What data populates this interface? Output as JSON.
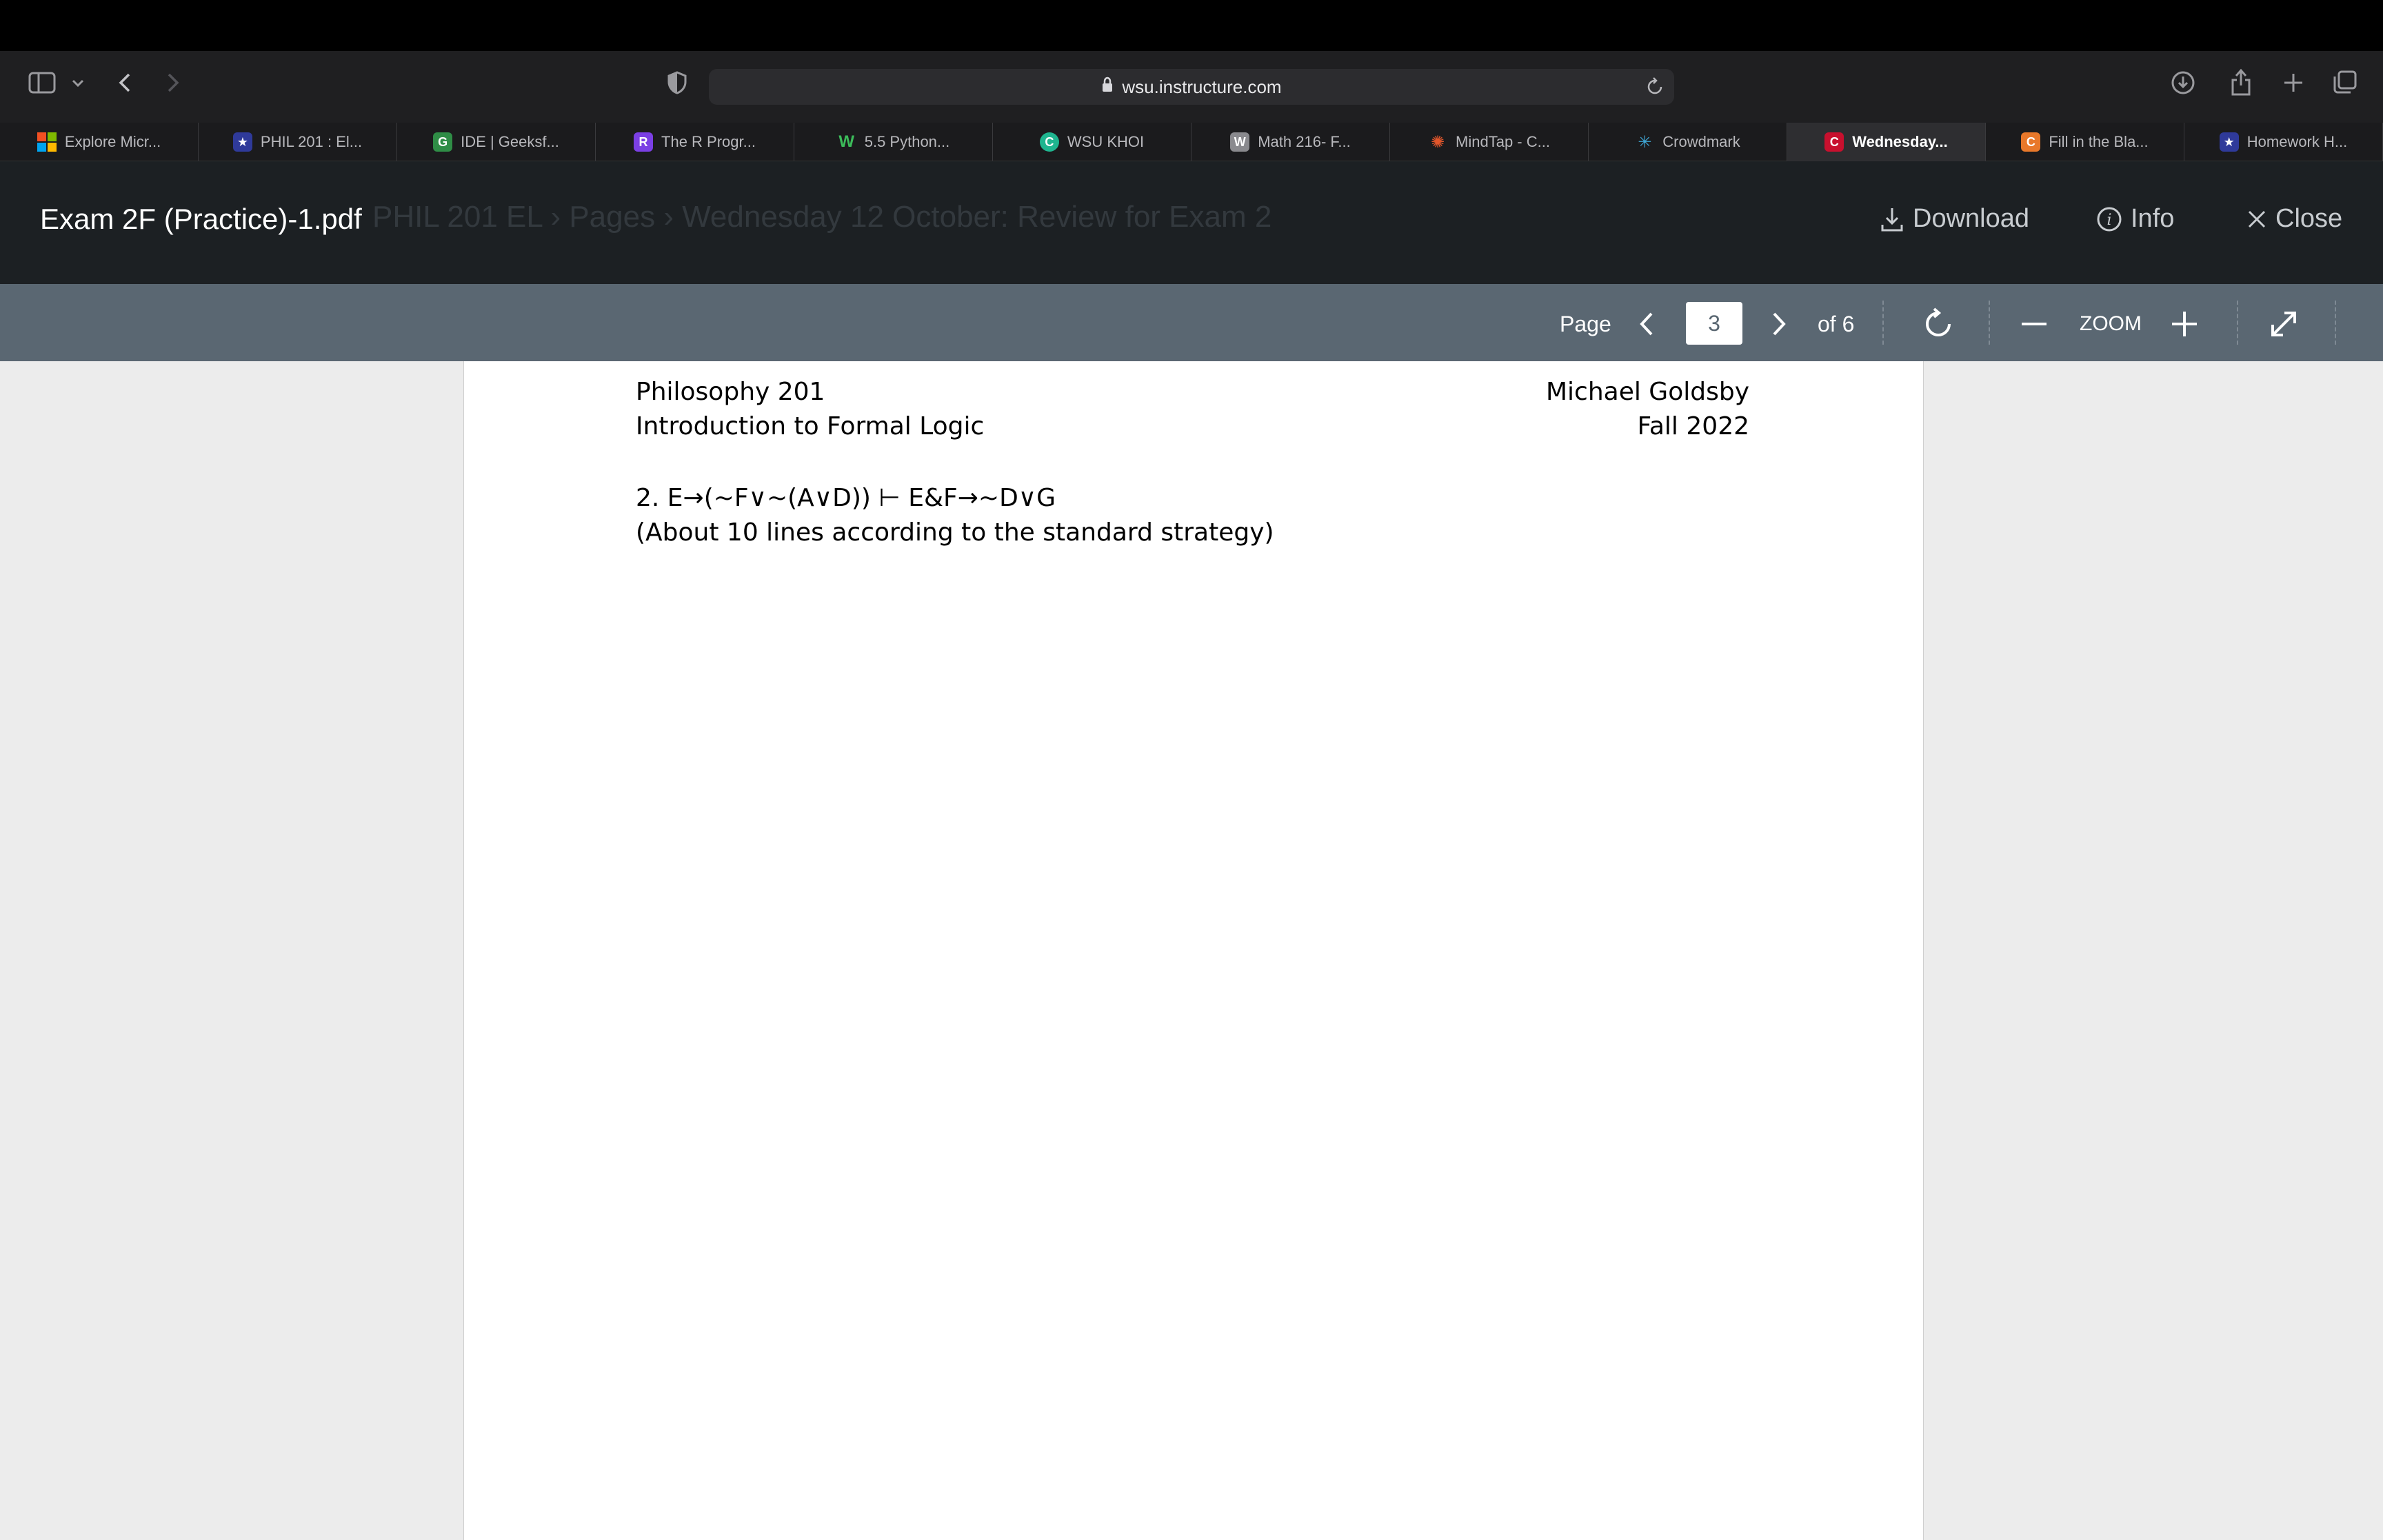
{
  "browser": {
    "url": "wsu.instructure.com",
    "tabs": [
      {
        "label": "Explore Micr...",
        "icon": "microsoft-icon",
        "color": "#f25022"
      },
      {
        "label": "PHIL 201 : El...",
        "icon": "star-badge-icon",
        "color": "#2f3a9a"
      },
      {
        "label": "IDE | Geeksf...",
        "icon": "geeksforgeeks-icon",
        "color": "#2f8d46"
      },
      {
        "label": "The R Progr...",
        "icon": "r-program-icon",
        "color": "#7b3fe4"
      },
      {
        "label": "5.5 Python...",
        "icon": "w-green-icon",
        "color": "#3cbc5a"
      },
      {
        "label": "WSU KHOI",
        "icon": "khoi-icon",
        "color": "#1fb58f"
      },
      {
        "label": "Math 216- F...",
        "icon": "w-square-icon",
        "color": "#8a8a8e"
      },
      {
        "label": "MindTap - C...",
        "icon": "mindtap-icon",
        "color": "#e2562b"
      },
      {
        "label": "Crowdmark",
        "icon": "crowdmark-icon",
        "color": "#3fa7d6"
      },
      {
        "label": "Wednesday...",
        "icon": "canvas-icon",
        "color": "#c8102e",
        "active": true
      },
      {
        "label": "Fill in the Bla...",
        "icon": "c-orange-icon",
        "color": "#e8782a"
      },
      {
        "label": "Homework H...",
        "icon": "star-badge-icon",
        "color": "#2f3a9a"
      }
    ]
  },
  "viewer": {
    "title": "Exam 2F (Practice)-1.pdf",
    "ghost_breadcrumb": "PHIL 201 EL  ›  Pages  ›  Wednesday 12 October: Review for Exam 2",
    "download_label": "Download",
    "info_label": "Info",
    "close_label": "Close"
  },
  "pdf_toolbar": {
    "page_label": "Page",
    "current_page": "3",
    "of_label": "of 6",
    "zoom_label": "ZOOM"
  },
  "page": {
    "course": "Philosophy 201",
    "course_title": "Introduction to Formal Logic",
    "instructor": "Michael Goldsby",
    "term": "Fall 2022",
    "problem": "2. E→(~F∨~(A∨D)) ⊢ E&F→~D∨G",
    "note": "(About 10 lines according to the standard strategy)"
  }
}
